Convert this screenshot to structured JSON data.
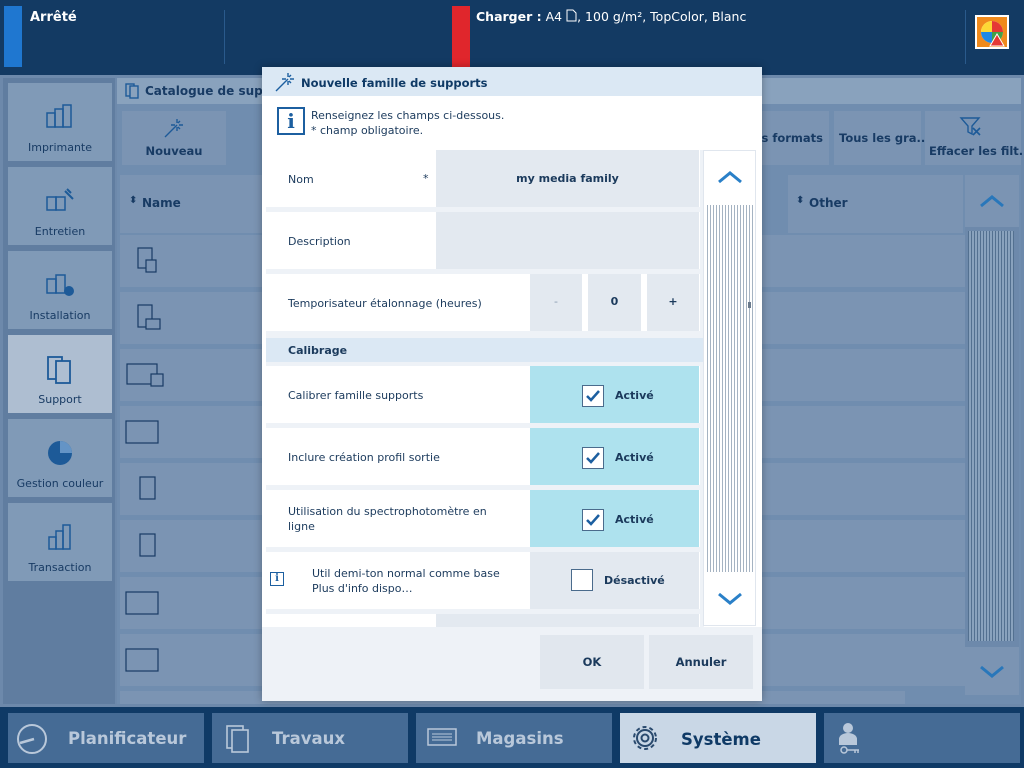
{
  "topbar": {
    "status": "Arrêté",
    "load_label": "Charger :",
    "load_size": "A4",
    "load_details": ", 100 g/m², TopColor, Blanc",
    "status_color": "#1f77d0",
    "load_color": "#e0262c"
  },
  "sidebar": {
    "items": [
      {
        "label": "Imprimante",
        "icon": "printer-icon"
      },
      {
        "label": "Entretien",
        "icon": "maintenance-icon"
      },
      {
        "label": "Installation",
        "icon": "installation-icon"
      },
      {
        "label": "Support",
        "icon": "media-icon"
      },
      {
        "label": "Gestion couleur",
        "icon": "color-management-icon"
      },
      {
        "label": "Transaction",
        "icon": "transaction-icon"
      }
    ],
    "active": "Support"
  },
  "catalog": {
    "title": "Catalogue de supports",
    "toolbar": {
      "new_label": "Nouveau",
      "all_formats": "Tous les formats",
      "all_weights": "Tous les gra...",
      "clear_filters": "Effacer les filt..."
    },
    "columns": {
      "name": "Name",
      "other": "Other"
    }
  },
  "dialog": {
    "title": "Nouvelle famille de supports",
    "info_line1": "Renseignez les champs ci-dessous.",
    "info_line2": "* champ obligatoire.",
    "name_label": "Nom",
    "required_mark": "*",
    "name_value": "my media family",
    "description_label": "Description",
    "timer_label": "Temporisateur étalonnage (heures)",
    "timer_minus": "-",
    "timer_value": "0",
    "timer_plus": "+",
    "calibration_section": "Calibrage",
    "calib_family_label": "Calibrer famille supports",
    "calib_family_state": "Activé",
    "output_profile_label": "Inclure création profil sortie",
    "output_profile_state": "Activé",
    "spectro_label_1": "Utilisation du spectrophotomètre en",
    "spectro_label_2": "ligne",
    "spectro_state": "Activé",
    "halftone_label_1": "Util demi-ton normal comme base",
    "halftone_label_2": "Plus d'info dispo…",
    "halftone_state": "Désactivé",
    "ok_label": "OK",
    "cancel_label": "Annuler"
  },
  "bottom_nav": {
    "planner": "Planificateur",
    "jobs": "Travaux",
    "trays": "Magasins",
    "system": "Système",
    "active": "Système"
  }
}
